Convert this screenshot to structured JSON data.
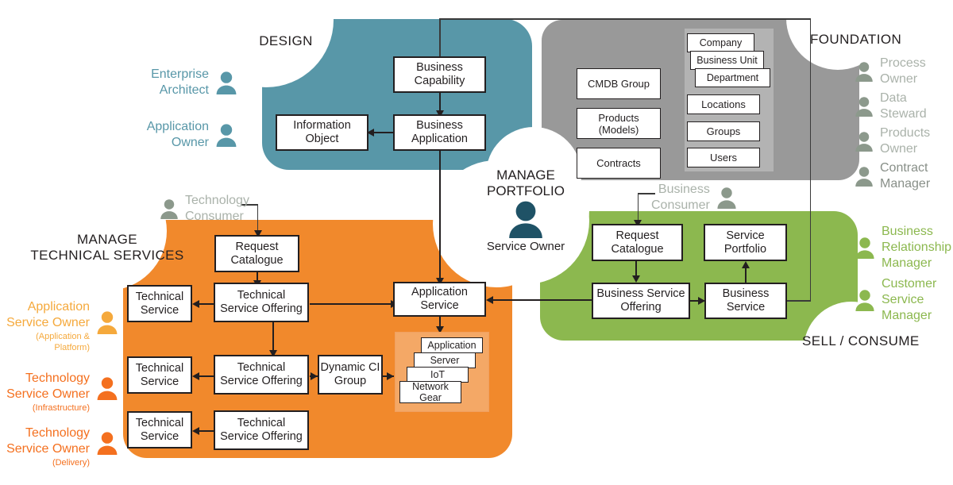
{
  "zones": {
    "design": {
      "title": "DESIGN",
      "color": "#5897a8"
    },
    "foundation": {
      "title": "FOUNDATION",
      "color": "#999999"
    },
    "technical": {
      "title": "MANAGE\nTECHNICAL SERVICES",
      "color": "#f1892c"
    },
    "sell": {
      "title": "SELL / CONSUME",
      "color": "#8cb84f"
    },
    "portfolio": {
      "title": "MANAGE\nPORTFOLIO",
      "owner": "Service Owner",
      "color": "#1f5266"
    }
  },
  "design_nodes": {
    "business_capability": "Business\nCapability",
    "business_application": "Business\nApplication",
    "information_object": "Information\nObject"
  },
  "foundation_nodes": {
    "cmdb_group": "CMDB Group",
    "products_models": "Products\n(Models)",
    "contracts": "Contracts",
    "company": "Company",
    "business_unit": "Business Unit",
    "department": "Department",
    "locations": "Locations",
    "groups": "Groups",
    "users": "Users"
  },
  "technical_nodes": {
    "request_catalogue": "Request\nCatalogue",
    "technical_service_1": "Technical\nService",
    "technical_service_2": "Technical\nService",
    "technical_service_3": "Technical\nService",
    "technical_service_offering_1": "Technical\nService Offering",
    "technical_service_offering_2": "Technical\nService Offering",
    "technical_service_offering_3": "Technical\nService Offering",
    "dynamic_ci_group": "Dynamic CI\nGroup",
    "application_service": "Application\nService",
    "ci_stack": [
      "Application",
      "Server",
      "IoT",
      "Network\nGear"
    ]
  },
  "sell_nodes": {
    "request_catalogue": "Request\nCatalogue",
    "service_portfolio": "Service\nPortfolio",
    "business_service_offering": "Business Service\nOffering",
    "business_service": "Business\nService"
  },
  "personas": {
    "design": [
      {
        "name": "Enterprise\nArchitect",
        "color": "#5897a8"
      },
      {
        "name": "Application\nOwner",
        "color": "#5897a8"
      }
    ],
    "foundation": [
      {
        "name": "Process\nOwner",
        "color": "#8c998c"
      },
      {
        "name": "Data\nSteward",
        "color": "#8c998c"
      },
      {
        "name": "Products\nOwner",
        "color": "#8c998c"
      },
      {
        "name": "Contract\nManager",
        "color": "#8c998c"
      }
    ],
    "technical": [
      {
        "name": "Application\nService Owner",
        "sub": "(Application & Platform)",
        "color": "#f5a93c"
      },
      {
        "name": "Technology\nService Owner",
        "sub": "(Infrastructure)",
        "color": "#f4701f"
      },
      {
        "name": "Technology\nService Owner",
        "sub": "(Delivery)",
        "color": "#f4701f"
      }
    ],
    "sell": [
      {
        "name": "Business\nRelationship\nManager",
        "color": "#8cb84f"
      },
      {
        "name": "Customer\nService\nManager",
        "color": "#8cb84f"
      }
    ],
    "consumers": [
      {
        "name": "Technology\nConsumer",
        "color": "#8c998c"
      },
      {
        "name": "Business\nConsumer",
        "color": "#8c998c"
      }
    ]
  }
}
